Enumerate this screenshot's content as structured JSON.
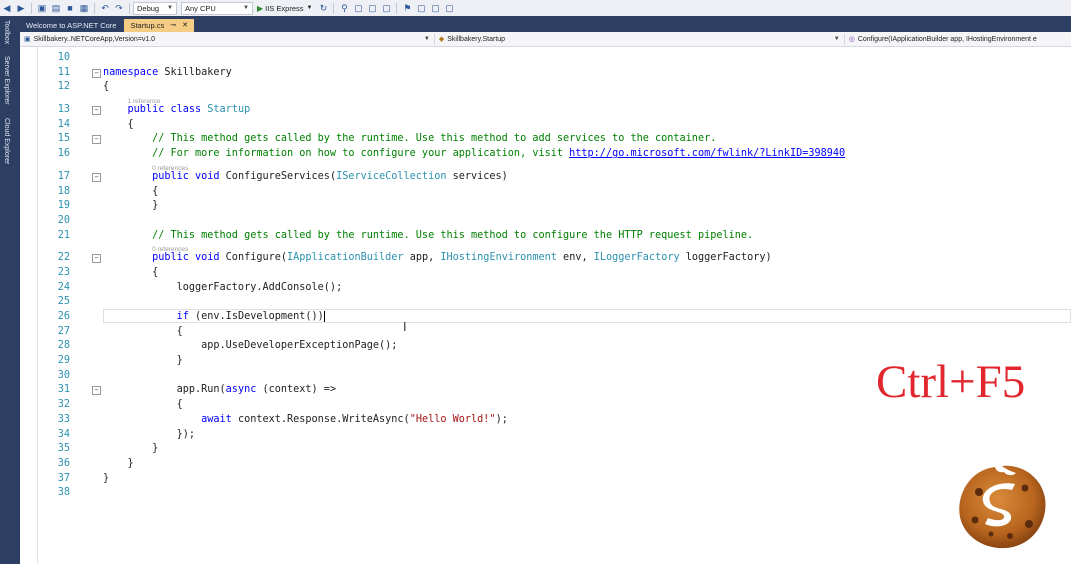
{
  "toolbar": {
    "config": "Debug",
    "platform": "Any CPU",
    "run_target": "IIS Express"
  },
  "side_tabs": [
    "Toolbox",
    "Server Explorer",
    "Cloud Explorer"
  ],
  "tabs": [
    {
      "label": "Welcome to ASP.NET Core",
      "active": false
    },
    {
      "label": "Startup.cs",
      "active": true
    }
  ],
  "nav": {
    "project": "Skillbakery..NETCoreApp,Version=v1.0",
    "class": "Skillbakery.Startup",
    "member": "Configure(IApplicationBuilder app, IHostingEnvironment e"
  },
  "code": {
    "lines": [
      {
        "n": "10",
        "tokens": []
      },
      {
        "n": "11",
        "tokens": [
          {
            "t": "namespace",
            "c": "kw"
          },
          {
            "t": " Skillbakery",
            "c": ""
          }
        ]
      },
      {
        "n": "12",
        "tokens": [
          {
            "t": "{",
            "c": ""
          }
        ]
      },
      {
        "n": "13",
        "ref": "1 reference",
        "tokens": [
          {
            "t": "    public class ",
            "c": "kw"
          },
          {
            "t": "Startup",
            "c": "ty"
          }
        ]
      },
      {
        "n": "14",
        "tokens": [
          {
            "t": "    {",
            "c": ""
          }
        ]
      },
      {
        "n": "15",
        "tokens": [
          {
            "t": "        // This method gets called by the runtime. Use this method to add services to the container.",
            "c": "cm"
          }
        ]
      },
      {
        "n": "16",
        "tokens": [
          {
            "t": "        // For more information on how to configure your application, visit ",
            "c": "cm"
          },
          {
            "t": "http://go.microsoft.com/fwlink/?LinkID=398940",
            "c": "lk"
          }
        ]
      },
      {
        "n": "17",
        "ref": "0 references",
        "tokens": [
          {
            "t": "        public void ",
            "c": "kw"
          },
          {
            "t": "ConfigureServices(",
            "c": ""
          },
          {
            "t": "IServiceCollection",
            "c": "ty"
          },
          {
            "t": " services)",
            "c": ""
          }
        ]
      },
      {
        "n": "18",
        "tokens": [
          {
            "t": "        {",
            "c": ""
          }
        ]
      },
      {
        "n": "19",
        "tokens": [
          {
            "t": "        }",
            "c": ""
          }
        ]
      },
      {
        "n": "20",
        "tokens": []
      },
      {
        "n": "21",
        "tokens": [
          {
            "t": "        // This method gets called by the runtime. Use this method to configure the HTTP request pipeline.",
            "c": "cm"
          }
        ]
      },
      {
        "n": "22",
        "ref": "0 references",
        "tokens": [
          {
            "t": "        public void ",
            "c": "kw"
          },
          {
            "t": "Configure(",
            "c": ""
          },
          {
            "t": "IApplicationBuilder",
            "c": "ty"
          },
          {
            "t": " app, ",
            "c": ""
          },
          {
            "t": "IHostingEnvironment",
            "c": "ty"
          },
          {
            "t": " env, ",
            "c": ""
          },
          {
            "t": "ILoggerFactory",
            "c": "ty"
          },
          {
            "t": " loggerFactory)",
            "c": ""
          }
        ]
      },
      {
        "n": "23",
        "tokens": [
          {
            "t": "        {",
            "c": ""
          }
        ]
      },
      {
        "n": "24",
        "tokens": [
          {
            "t": "            loggerFactory.AddConsole();",
            "c": ""
          }
        ]
      },
      {
        "n": "25",
        "tokens": []
      },
      {
        "n": "26",
        "current": true,
        "tokens": [
          {
            "t": "            if ",
            "c": "kw"
          },
          {
            "t": "(env.IsDevelopment())",
            "c": ""
          }
        ]
      },
      {
        "n": "27",
        "tokens": [
          {
            "t": "            {",
            "c": ""
          }
        ]
      },
      {
        "n": "28",
        "tokens": [
          {
            "t": "                app.UseDeveloperExceptionPage();",
            "c": ""
          }
        ]
      },
      {
        "n": "29",
        "tokens": [
          {
            "t": "            }",
            "c": ""
          }
        ]
      },
      {
        "n": "30",
        "tokens": []
      },
      {
        "n": "31",
        "tokens": [
          {
            "t": "            app.Run(",
            "c": ""
          },
          {
            "t": "async",
            "c": "kw"
          },
          {
            "t": " (context) =>",
            "c": ""
          }
        ]
      },
      {
        "n": "32",
        "tokens": [
          {
            "t": "            {",
            "c": ""
          }
        ]
      },
      {
        "n": "33",
        "tokens": [
          {
            "t": "                ",
            "c": ""
          },
          {
            "t": "await",
            "c": "kw"
          },
          {
            "t": " context.Response.WriteAsync(",
            "c": ""
          },
          {
            "t": "\"Hello World!\"",
            "c": "st"
          },
          {
            "t": ");",
            "c": ""
          }
        ]
      },
      {
        "n": "34",
        "tokens": [
          {
            "t": "            });",
            "c": ""
          }
        ]
      },
      {
        "n": "35",
        "tokens": [
          {
            "t": "        }",
            "c": ""
          }
        ]
      },
      {
        "n": "36",
        "tokens": [
          {
            "t": "    }",
            "c": ""
          }
        ]
      },
      {
        "n": "37",
        "tokens": [
          {
            "t": "}",
            "c": ""
          }
        ]
      },
      {
        "n": "38",
        "tokens": []
      }
    ]
  },
  "overlay": {
    "shortcut": "Ctrl+F5",
    "shortcut_color": "#e1262d"
  },
  "icons": {
    "logo": "skillbakery-cookie-logo"
  }
}
